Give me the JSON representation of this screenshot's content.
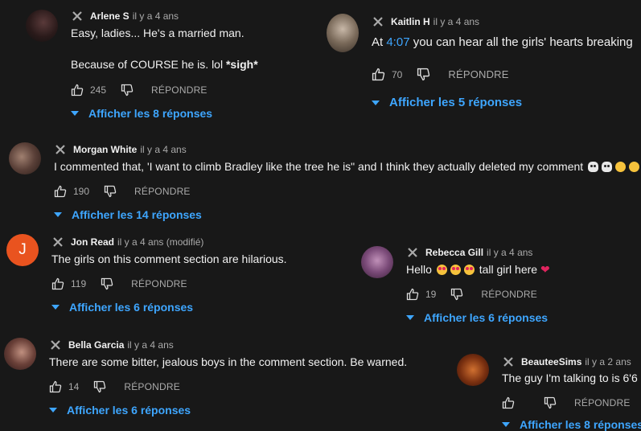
{
  "ui": {
    "reply_label": "RÉPONDRE"
  },
  "comments": [
    {
      "author": "Arlene S",
      "date": "il y a 4 ans",
      "line1": "Easy, ladies... He's a married man.",
      "line2_prefix": "Because of COURSE he is. lol ",
      "line2_bold": "*sigh*",
      "likes": "245",
      "replies": "Afficher les 8 réponses",
      "avatar": "profile-photo"
    },
    {
      "author": "Kaitlin H",
      "date": "il y a 4 ans",
      "text_prefix": "At ",
      "timestamp": "4:07",
      "text_suffix": " you can hear all the girls' hearts breaking",
      "likes": "70",
      "replies": "Afficher les 5 réponses",
      "avatar": "profile-photo"
    },
    {
      "author": "Morgan White",
      "date": "il y a 4 ans",
      "text": "I commented that, 'I want to climb Bradley like the tree he is\" and I think they actually deleted my comment",
      "emojis": [
        "skull",
        "skull",
        "laughing",
        "laughing"
      ],
      "likes": "190",
      "replies": "Afficher les 14 réponses",
      "avatar": "profile-photo"
    },
    {
      "author": "Jon Read",
      "date": "il y a 4 ans (modifié)",
      "text": "The girls on this comment section are hilarious.",
      "likes": "119",
      "replies": "Afficher les 6 réponses",
      "avatar_letter": "J",
      "avatar_color": "#e9531f"
    },
    {
      "author": "Rebecca Gill",
      "date": "il y a 4 ans",
      "text_prefix": "Hello",
      "text_suffix": "tall girl here",
      "emojis": [
        "heart-eyes",
        "heart-eyes",
        "heart-eyes",
        "red-heart"
      ],
      "likes": "19",
      "replies": "Afficher les 6 réponses",
      "avatar": "profile-photo"
    },
    {
      "author": "Bella Garcia",
      "date": "il y a 4 ans",
      "text": "There are some bitter, jealous boys in the comment section. Be warned.",
      "likes": "14",
      "replies": "Afficher les 6 réponses",
      "avatar": "profile-photo"
    },
    {
      "author": "BeauteeSims",
      "date": "il y a 2 ans",
      "text": "The guy I'm talking to is 6'6",
      "likes": "",
      "replies": "Afficher les 8 réponses",
      "avatar": "profile-photo"
    }
  ],
  "colors": {
    "background": "#181818",
    "link": "#3ea6ff",
    "secondary_text": "#aaaaaa",
    "primary_text": "#f1f1f1"
  }
}
